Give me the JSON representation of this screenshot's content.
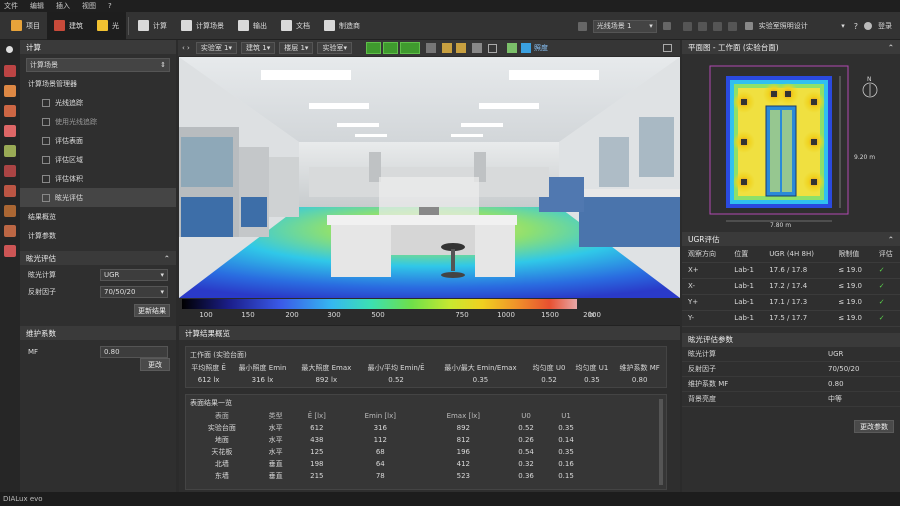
{
  "menu": [
    "文件",
    "编辑",
    "插入",
    "视图",
    "?"
  ],
  "toolbar": {
    "items": [
      {
        "label": "项目",
        "icon": "project-icon",
        "color": "#e8a33a",
        "active": false
      },
      {
        "label": "建筑",
        "icon": "building-icon",
        "color": "#c84a3a",
        "active": true
      },
      {
        "label": "光",
        "icon": "light-icon",
        "color": "#f2c231",
        "active": true
      },
      {
        "label": "计算",
        "icon": "calc-icon",
        "color": "#d9d9d9",
        "active": false
      },
      {
        "label": "计算场景",
        "icon": "scene-icon",
        "color": "#d9d9d9",
        "active": false
      },
      {
        "label": "输出",
        "icon": "output-icon",
        "color": "#d9d9d9",
        "active": false
      },
      {
        "label": "文档",
        "icon": "document-icon",
        "color": "#d9d9d9",
        "active": false
      },
      {
        "label": "制造商",
        "icon": "manufacturer-icon",
        "color": "#d9d9d9",
        "active": false
      }
    ],
    "scene_select": "光线场景 1",
    "project_name": "实验室照明设计",
    "login": "登录"
  },
  "left": {
    "calc_header": "计算",
    "scene_dropdown": "计算场景",
    "nav": [
      {
        "label": "计算场景管理器",
        "style": "main",
        "dim": false,
        "sel": false
      },
      {
        "label": "光线追踪",
        "style": "sub",
        "dim": false,
        "sel": false
      },
      {
        "label": "使用光线追踪",
        "style": "sub",
        "dim": true,
        "sel": false
      },
      {
        "label": "评估表面",
        "style": "sub",
        "dim": false,
        "sel": false
      },
      {
        "label": "评估区域",
        "style": "sub",
        "dim": false,
        "sel": false
      },
      {
        "label": "评估体积",
        "style": "sub",
        "dim": false,
        "sel": false
      },
      {
        "label": "眩光评估",
        "style": "sub",
        "dim": false,
        "sel": true
      },
      {
        "label": "结果概览",
        "style": "main",
        "dim": false,
        "sel": false
      },
      {
        "label": "计算参数",
        "style": "main",
        "dim": false,
        "sel": false
      }
    ],
    "glare_header": "眩光评估",
    "glare_calc_label": "眩光计算",
    "glare_calc_value": "UGR",
    "reflect_label": "反射因子",
    "reflect_value": "70/50/20",
    "update_btn": "更新结果",
    "maint_header": "维护系数",
    "mf_label": "MF",
    "mf_value": "0.80",
    "change_btn": "更改"
  },
  "viewbar": {
    "selects": [
      "实验室 1",
      "建筑 1",
      "楼层 1",
      "实验室"
    ],
    "label": "照度"
  },
  "colorbar": {
    "ticks": [
      "100",
      "150",
      "200",
      "300",
      "500",
      "750",
      "1000",
      "1500",
      "2000",
      "lx"
    ]
  },
  "results": {
    "header": "计算结果概览",
    "workplane_title": "工作面 (实验台面)",
    "summary": {
      "headers": [
        "平均照度 Ē",
        "最小照度 Emin",
        "最大照度 Emax",
        "最小/平均 Emin/Ē",
        "最小/最大 Emin/Emax",
        "均匀度 U0",
        "均匀度 U1",
        "维护系数 MF"
      ],
      "values": [
        "612 lx",
        "316 lx",
        "892 lx",
        "0.52",
        "0.35",
        "0.52",
        "0.35",
        "0.80"
      ]
    },
    "surface_title": "表面结果一览",
    "table_headers": [
      "表面",
      "类型",
      "Ē [lx]",
      "Emin [lx]",
      "Emax [lx]",
      "U0",
      "U1"
    ],
    "rows": [
      [
        "实验台面",
        "水平",
        "612",
        "316",
        "892",
        "0.52",
        "0.35"
      ],
      [
        "地面",
        "水平",
        "438",
        "112",
        "812",
        "0.26",
        "0.14"
      ],
      [
        "天花板",
        "水平",
        "125",
        "68",
        "196",
        "0.54",
        "0.35"
      ],
      [
        "北墙",
        "垂直",
        "198",
        "64",
        "412",
        "0.32",
        "0.16"
      ],
      [
        "东墙",
        "垂直",
        "215",
        "78",
        "523",
        "0.36",
        "0.15"
      ]
    ]
  },
  "right": {
    "plan_header": "平面图 - 工作面 (实验台面)",
    "north": "N",
    "dim_h": "9.20 m",
    "dim_w": "7.80 m",
    "ugr_header": "UGR评估",
    "ugr_cols": [
      "观察方向",
      "位置",
      "UGR (4H 8H)",
      "限制值",
      "评估"
    ],
    "ugr_rows": [
      [
        "X+",
        "Lab-1",
        "17.6 / 17.8",
        "≤ 19.0"
      ],
      [
        "X-",
        "Lab-1",
        "17.2 / 17.4",
        "≤ 19.0"
      ],
      [
        "Y+",
        "Lab-1",
        "17.1 / 17.3",
        "≤ 19.0"
      ],
      [
        "Y-",
        "Lab-1",
        "17.5 / 17.7",
        "≤ 19.0"
      ]
    ],
    "params_header": "眩光评估参数",
    "params": [
      [
        "眩光计算",
        "UGR"
      ],
      [
        "反射因子",
        "70/50/20"
      ],
      [
        "维护系数 MF",
        "0.80"
      ],
      [
        "背景亮度",
        "中等"
      ]
    ],
    "change_params_btn": "更改参数"
  },
  "status": "DIALux evo"
}
